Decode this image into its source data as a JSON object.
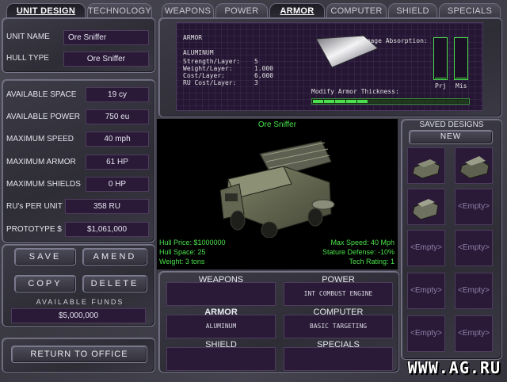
{
  "left_tabs": [
    "UNIT DESIGN",
    "TECHNOLOGY"
  ],
  "top_tabs": [
    "WEAPONS",
    "POWER",
    "ARMOR",
    "COMPUTER",
    "SHIELD",
    "SPECIALS"
  ],
  "unit_name_label": "UNIT NAME",
  "unit_name_value": "Ore Sniffer",
  "hull_type_label": "HULL TYPE",
  "hull_type_value": "Ore Sniffer",
  "stats": [
    {
      "label": "AVAILABLE SPACE",
      "value": "19 cy"
    },
    {
      "label": "AVAILABLE POWER",
      "value": "750 eu"
    },
    {
      "label": "MAXIMUM SPEED",
      "value": "40 mph"
    },
    {
      "label": "MAXIMUM ARMOR",
      "value": "61 HP"
    },
    {
      "label": "MAXIMUM SHIELDS",
      "value": "0 HP"
    },
    {
      "label": "RU's PER UNIT",
      "value": "358 RU"
    },
    {
      "label": "PROTOTYPE $",
      "value": "$1,061,000"
    }
  ],
  "buttons": {
    "save": "SAVE",
    "amend": "AMEND",
    "copy": "COPY",
    "delete": "DELETE",
    "return": "RETURN TO OFFICE"
  },
  "funds_label": "AVAILABLE FUNDS",
  "funds_value": "$5,000,000",
  "armor": {
    "heading": "ARMOR",
    "name": "ALUMINUM",
    "rows": [
      {
        "label": "Strength/Layer:",
        "value": "5"
      },
      {
        "label": "Weight/Layer:",
        "value": "1.000"
      },
      {
        "label": "Cost/Layer:",
        "value": "6,000"
      },
      {
        "label": "RU Cost/Layer:",
        "value": "3"
      }
    ],
    "damage_label": "Damage Absorption:",
    "bar_labels": [
      "Prj",
      "Mis"
    ],
    "bar_levels": [
      0.02,
      0.02
    ],
    "thickness_label": "Modify Armor Thickness:",
    "thickness_segments": 14,
    "thickness_filled": 5
  },
  "unit_view": {
    "title": "Ore Sniffer",
    "left_stats": [
      "Hull Price: $1000000",
      "Hull Space: 25",
      "Weight: 3 tons"
    ],
    "right_stats": [
      "Max Speed: 40 Mph",
      "Stature Defense: -10%",
      "Tech Rating: 1"
    ]
  },
  "categories": [
    {
      "label": "WEAPONS",
      "value": ""
    },
    {
      "label": "POWER",
      "value": "INT COMBUST ENGINE"
    },
    {
      "label": "ARMOR",
      "value": "ALUMINUM"
    },
    {
      "label": "COMPUTER",
      "value": "BASIC TARGETING"
    },
    {
      "label": "SHIELD",
      "value": ""
    },
    {
      "label": "SPECIALS",
      "value": ""
    }
  ],
  "saved_designs": {
    "title": "SAVED DESIGNS",
    "new_label": "NEW",
    "empty_label": "<Empty>"
  },
  "watermark": "WWW.AG.RU"
}
